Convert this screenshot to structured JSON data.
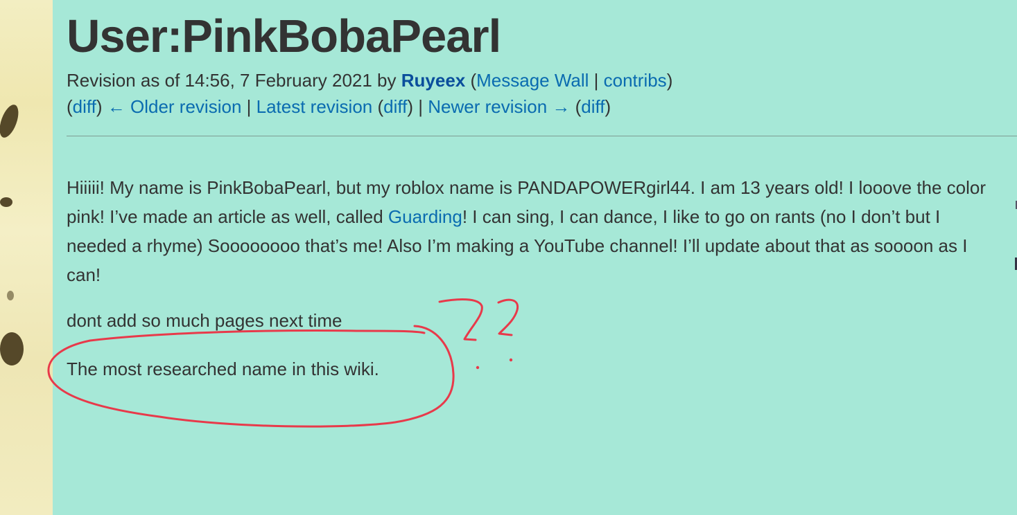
{
  "page": {
    "title": "User:PinkBobaPearl"
  },
  "revision": {
    "prefix": "Revision as of 14:56, 7 February 2021 by ",
    "user": "Ruyeex",
    "open_paren": " (",
    "message_wall": "Message Wall",
    "sep": " | ",
    "contribs": "contribs",
    "close_paren": ")"
  },
  "nav": {
    "open1": "(",
    "diff1": "diff",
    "close1": ") ",
    "older": "← Older revision",
    "sep1": " | ",
    "latest": "Latest revision",
    "open2": " (",
    "diff2": "diff",
    "close2": ") | ",
    "newer": "Newer revision →",
    "open3": " (",
    "diff3": "diff",
    "close3": ")"
  },
  "article": {
    "p1_before": "Hiiiii! My name is PinkBobaPearl, but my roblox name is PANDAPOWERgirl44. I am 13 years old! I looove the color pink! I’ve made an article as well, called ",
    "p1_link": "Guarding",
    "p1_after": "! I can sing, I can dance, I like to go on rants (no I don’t but I needed a rhyme) Soooooooo that’s me! Also I’m making a YouTube channel! I’ll update about that as soooon as I can!",
    "p2": "dont add so much pages next time",
    "p3": "The most researched name in this wiki."
  },
  "annotation": {
    "color": "#e8394a"
  }
}
